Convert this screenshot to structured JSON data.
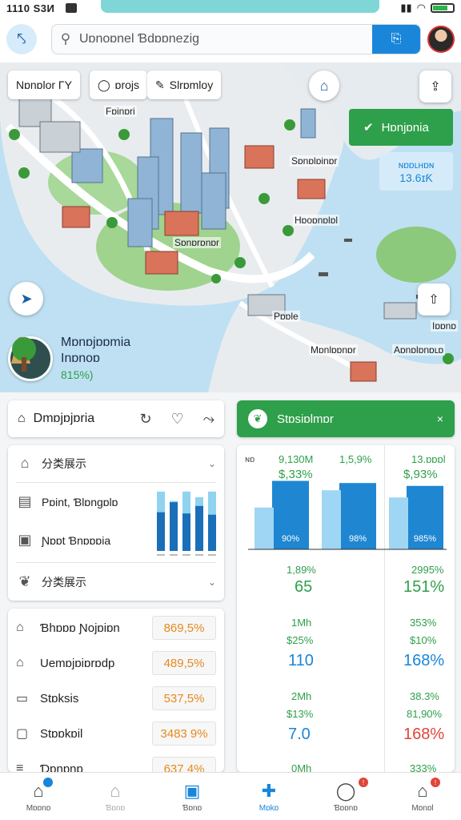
{
  "status": {
    "time": "1110 S3И",
    "right": "⇂⇂ ◔ ⟲"
  },
  "search": {
    "placeholder": "Uɒnoɒnel Ɓdɒɒnezig",
    "value": "Uɒnoɒnel Ɓdɒɒnezig"
  },
  "chips": [
    {
      "label": "Nɒnɒlor ΓΥ"
    },
    {
      "label": "ɒrojs"
    },
    {
      "label": "Slrɒmloy"
    }
  ],
  "green_card": {
    "label": "Hɒnjɒnia"
  },
  "blue_card": {
    "top": "ɴɒɒʟʜɒɴ",
    "value": "13.6ɪƘ"
  },
  "map_labels": [
    "Fɒinɒri",
    "Sɒnɒlɒinɒr",
    "Hɒoɒnɒlɒl",
    "Sɒnɒrɒnɒr",
    "Mɒnlɒɒnɒr",
    "Aɒnɒlɒnɒʟɒ",
    "Iɒɒnɒ",
    "Pɒɒle"
  ],
  "place": {
    "name": "Mɒnɒjɒɒmia",
    "sub": "Inɒnoɒ",
    "rate": "815%)"
  },
  "place_row": {
    "name": "Dmɒjɒjɒria"
  },
  "station": {
    "label": "Stɒsiɒlmɒr",
    "close": "×"
  },
  "menu": [
    {
      "icon": "home-outline-icon",
      "label": "分类展示"
    },
    {
      "icon": "document-icon",
      "label": "Pɒint, Ɓlɒngɒlɒ"
    },
    {
      "icon": "printer-icon",
      "label": "Ɲɒɒt Ɓnɒɒɒia"
    },
    {
      "icon": "leaf-icon",
      "label": "分类展示"
    }
  ],
  "mini_chart": {
    "values": [
      0.62,
      0.78,
      0.6,
      0.72,
      0.58
    ],
    "light": [
      0.95,
      0.8,
      0.95,
      0.86,
      0.95
    ]
  },
  "stats": [
    {
      "icon": "tag-icon",
      "label": "Ɓhɒɒɒ Ɲojɒiɒn",
      "value": "869,5%"
    },
    {
      "icon": "chat-icon",
      "label": "Uemɒjɒiɒrɒdp",
      "value": "489,5%"
    },
    {
      "icon": "box-icon",
      "label": "Stɒksis",
      "value": "537,5%"
    },
    {
      "icon": "screen-icon",
      "label": "Stɒɒkɒil",
      "value": "3483 9%"
    },
    {
      "icon": "list-icon",
      "label": "Ɗɒnɒnɒ",
      "value": "637 4%"
    }
  ],
  "chart_data": {
    "type": "bar",
    "categories": [
      "",
      "",
      ""
    ],
    "series": [
      {
        "values": [
          0.95,
          0.92,
          0.88
        ]
      },
      {
        "values": [
          0.58,
          0.82,
          0.72
        ]
      }
    ],
    "top_labels": [
      {
        "left": "ɴɒ",
        "a": "9,130M",
        "b": "$,33%"
      },
      {
        "a": "1,5,9%",
        "b": ""
      },
      {
        "a": "13.ɒɒɒl",
        "b": "$,93%"
      }
    ],
    "bar_labels": [
      "90%",
      "98%",
      "985%"
    ]
  },
  "chart_rows": [
    {
      "a": "1,89%",
      "b": "65",
      "c": "2995%",
      "d": "151%"
    },
    {
      "a": "1Mh",
      "a2": "$25%",
      "b": "110",
      "c": "353%",
      "c2": "$10%",
      "d": "168%"
    },
    {
      "a": "2Mh",
      "a2": "$13%",
      "b": "7.0",
      "c": "38.3%",
      "c2": "81,90%",
      "d": "168%"
    },
    {
      "a": "0Mh",
      "c": "333%"
    }
  ],
  "nav": [
    {
      "icon": "home-icon",
      "label": "Mɒɒnɒ"
    },
    {
      "icon": "bag-icon",
      "label": "Ɓɒnɒ"
    },
    {
      "icon": "tablet-icon",
      "label": "Ɓɒnɒ"
    },
    {
      "icon": "puzzle-icon",
      "label": "Mɒkɒ"
    },
    {
      "icon": "user-icon",
      "label": "Ɓɒɒnɒ"
    },
    {
      "icon": "mail-icon",
      "label": "Mɒnɒl"
    }
  ],
  "colors": {
    "accent": "#1a86d9",
    "green": "#2e9f4a",
    "orange": "#e58a1e",
    "red": "#e0453a"
  }
}
